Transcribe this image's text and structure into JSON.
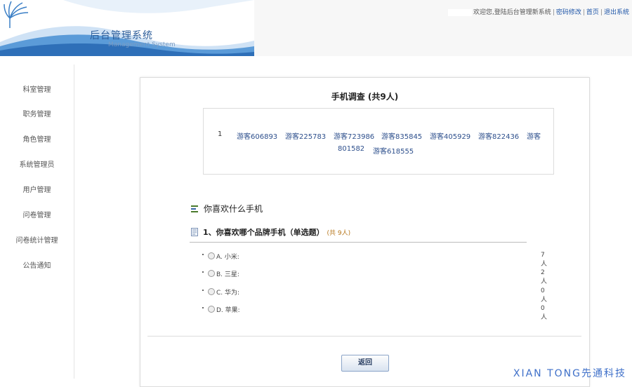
{
  "header": {
    "title": "后台管理系统",
    "subtitle": "Management System",
    "welcome": "欢迎您,登陆后台管理新系统",
    "links": [
      "密码修改",
      "首页",
      "退出系统"
    ]
  },
  "sidebar": {
    "items": [
      "科室管理",
      "职务管理",
      "角色管理",
      "系统管理员",
      "用户管理",
      "问卷管理",
      "问卷统计管理",
      "公告通知"
    ]
  },
  "survey": {
    "title": "手机调查 (共9人)",
    "respondent_index": "1",
    "respondents": [
      "游客606893",
      "游客225783",
      "游客723986",
      "游客835845",
      "游客405929",
      "游客822436",
      "游客",
      "801582",
      "游客618555"
    ],
    "section_title": "你喜欢什么手机",
    "question": {
      "title": "1、你喜欢哪个品牌手机（单选题）",
      "total": "(共 9人)",
      "options": [
        {
          "label": "A. 小米:",
          "count": "7人"
        },
        {
          "label": "B. 三星:",
          "count": "2人"
        },
        {
          "label": "C. 华为:",
          "count": "0人"
        },
        {
          "label": "D. 苹果:",
          "count": "0人"
        }
      ]
    },
    "back_label": "返回"
  },
  "watermark": "XIAN TONG先通科技",
  "colors": {
    "accent": "#2c5d9a",
    "link": "#1f56a8",
    "count": "#b6761b"
  }
}
